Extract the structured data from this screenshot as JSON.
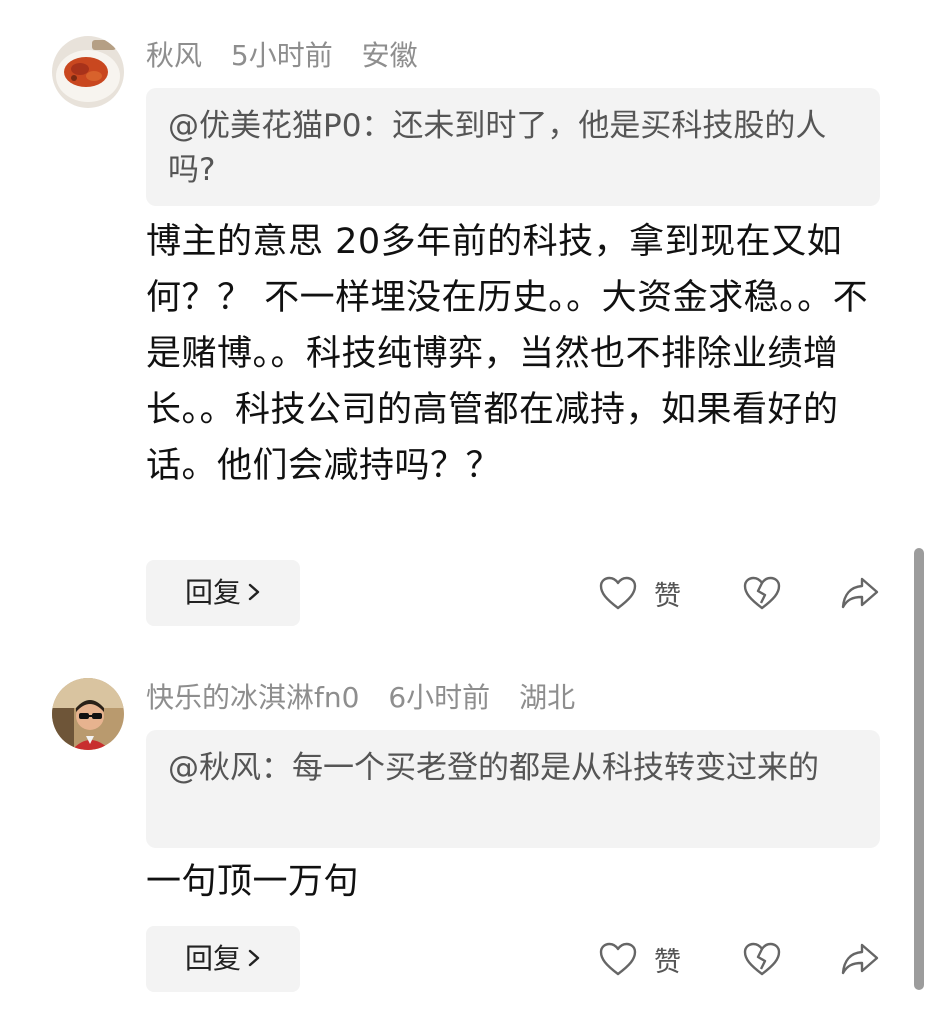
{
  "comments": [
    {
      "user": "秋风",
      "time": "5小时前",
      "location": "安徽",
      "quote": "@优美花猫P0：还未到时了，他是买科技股的人吗?",
      "text": "博主的意思 20多年前的科技，拿到现在又如何？？ 不一样埋没在历史。。大资金求稳。。不是赌博。。科技纯博弈，当然也不排除业绩增长。。科技公司的高管都在减持，如果看好的话。他们会减持吗？？",
      "reply_label": "回复",
      "like_label": "赞"
    },
    {
      "user": "快乐的冰淇淋fn0",
      "time": "6小时前",
      "location": "湖北",
      "quote": "@秋风：每一个买老登的都是从科技转变过来的",
      "text": "一句顶一万句",
      "reply_label": "回复",
      "like_label": "赞"
    }
  ],
  "icons": {
    "reply_chevron": "chevron-right-icon",
    "like": "heart-icon",
    "dislike": "broken-heart-icon",
    "share": "share-arrow-icon"
  },
  "colors": {
    "meta_text": "#8e8e8e",
    "quote_bg": "#f3f3f3",
    "quote_text": "#555555",
    "body_text": "#111111"
  }
}
